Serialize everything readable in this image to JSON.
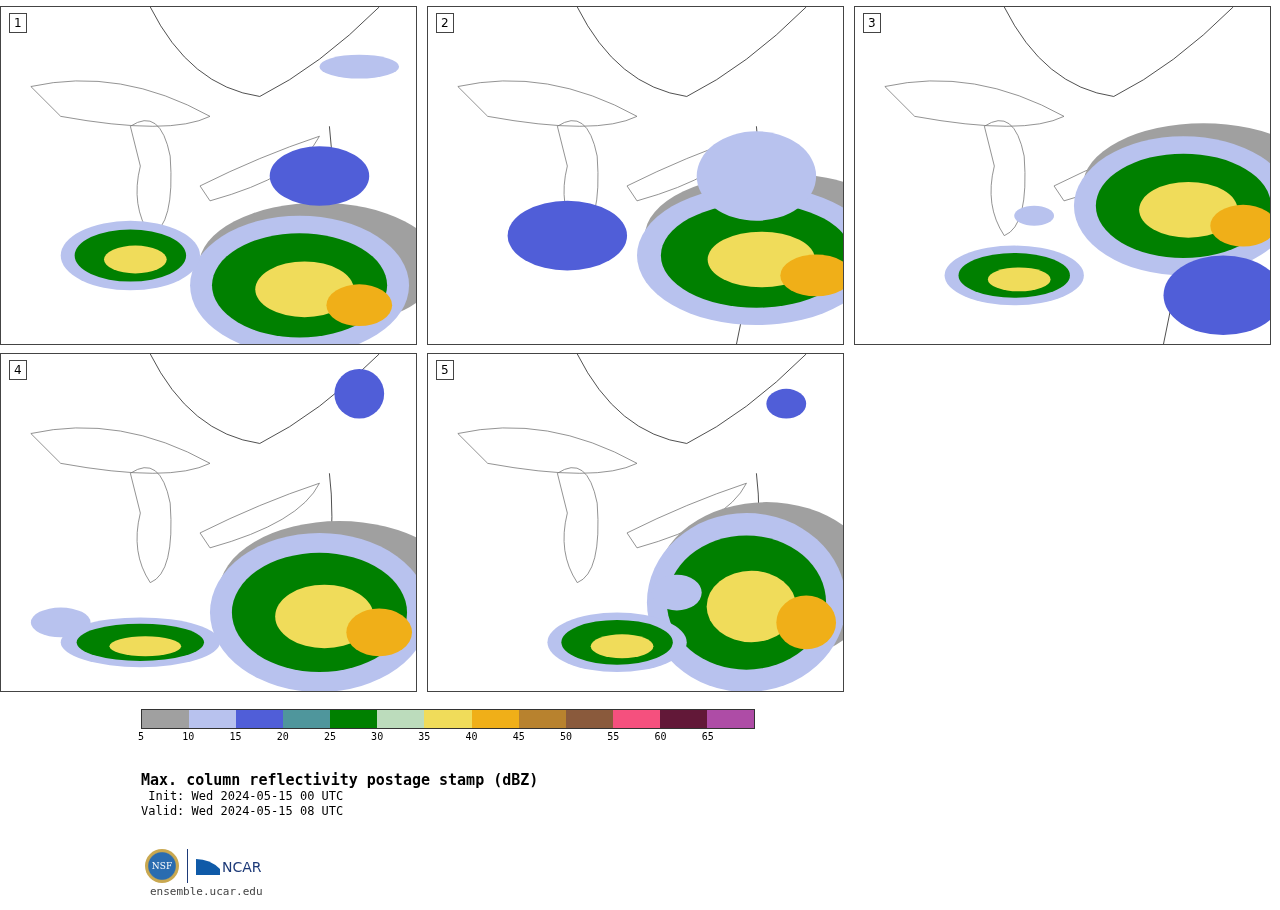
{
  "panels": [
    {
      "label": "1"
    },
    {
      "label": "2"
    },
    {
      "label": "3"
    },
    {
      "label": "4"
    },
    {
      "label": "5"
    }
  ],
  "colorbar": {
    "segments": [
      {
        "color": "#a0a0a0"
      },
      {
        "color": "#b8c2ee"
      },
      {
        "color": "#505ed8"
      },
      {
        "color": "#4f969c"
      },
      {
        "color": "#008000"
      },
      {
        "color": "#bcdcbc"
      },
      {
        "color": "#f0dc5a"
      },
      {
        "color": "#f0af18"
      },
      {
        "color": "#b8822e"
      },
      {
        "color": "#8a5a3c"
      },
      {
        "color": "#f5507e"
      },
      {
        "color": "#621838"
      },
      {
        "color": "#ae4ca6"
      }
    ],
    "ticks": [
      "5",
      "10",
      "15",
      "20",
      "25",
      "30",
      "35",
      "40",
      "45",
      "50",
      "55",
      "60",
      "65"
    ]
  },
  "title": "Max. column reflectivity postage stamp (dBZ)",
  "init": " Init: Wed 2024-05-15 00 UTC",
  "valid": "Valid: Wed 2024-05-15 08 UTC",
  "logos": {
    "nsf": "NSF",
    "ncar": "NCAR"
  },
  "url": "ensemble.ucar.edu"
}
